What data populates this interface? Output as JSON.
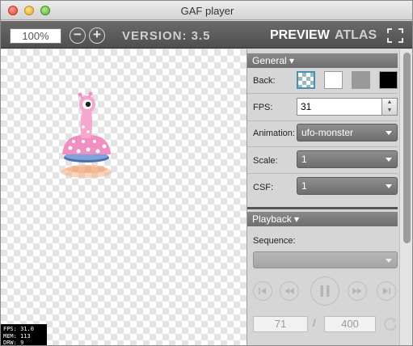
{
  "window": {
    "title": "GAF player"
  },
  "toolbar": {
    "zoom_value": "100%",
    "zoom_out_label": "−",
    "zoom_in_label": "+",
    "version": "VERSION: 3.5",
    "tab_preview": "PREVIEW",
    "tab_atlas": "ATLAS"
  },
  "stats": {
    "fps": "FPS: 31.0",
    "mem": "MEM: 113",
    "drw": "DRW: 9"
  },
  "general": {
    "header": "General ▾",
    "back_label": "Back:",
    "fps_label": "FPS:",
    "fps_value": "31",
    "animation_label": "Animation:",
    "animation_value": "ufo-monster",
    "scale_label": "Scale:",
    "scale_value": "1",
    "csf_label": "CSF:",
    "csf_value": "1"
  },
  "playback": {
    "header": "Playback ▾",
    "sequence_label": "Sequence:",
    "sequence_value": "",
    "current_frame": "71",
    "separator": "/",
    "total_frames": "400"
  },
  "icons": [
    "zoom-out-icon",
    "zoom-in-icon",
    "fullscreen-icon",
    "first-frame-icon",
    "prev-frame-icon",
    "pause-icon",
    "next-frame-icon",
    "last-frame-icon",
    "loop-icon"
  ],
  "colors": {
    "accent_selection": "#4a8fb3",
    "toolbar_bg": "#5c5c5c",
    "monster_pink": "#f08fc0"
  }
}
